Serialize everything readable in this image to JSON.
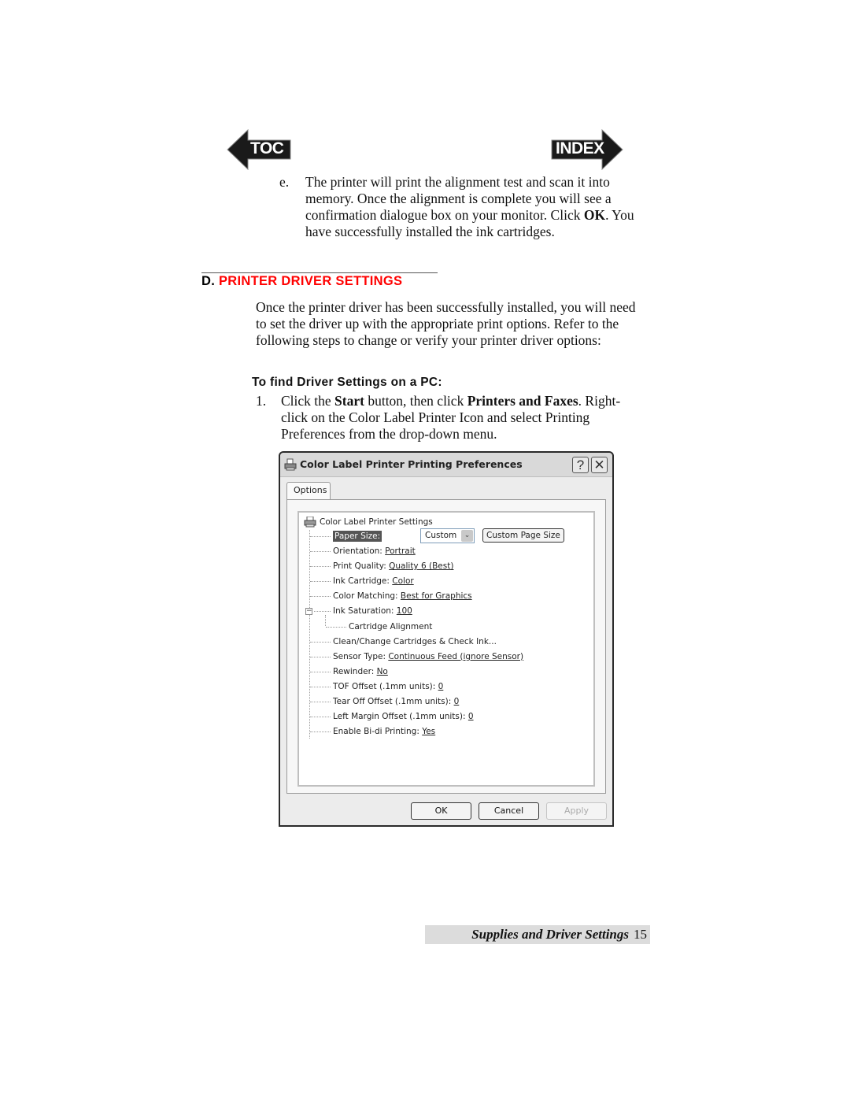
{
  "nav": {
    "toc_label": "TOC",
    "index_label": "INDEX"
  },
  "step_e": {
    "marker": "e.",
    "text_before_ok": "The printer will print the alignment test and scan it into memory.  Once the alignment is complete you will see a confirmation dialogue box on your monitor. Click ",
    "ok_bold": "OK",
    "text_after_ok": ".  You have successfully installed the ink cartridges."
  },
  "section": {
    "letter": "D.",
    "title": "PRINTER DRIVER SETTINGS",
    "title_color": "#ff0000"
  },
  "intro": "Once the printer driver has been successfully installed, you will need to set the driver up with the appropriate print options.  Refer to the following steps to change or verify your printer driver options:",
  "subheading": "To find Driver Settings on a PC:",
  "step_1": {
    "marker": "1.",
    "t1": "Click the ",
    "b1": "Start",
    "t2": " button, then click ",
    "b2": "Printers and Faxes",
    "t3": ". Right-click on the Color Label Printer Icon and select Printing Preferences from the drop-down menu."
  },
  "dialog": {
    "title": "Color Label Printer Printing Preferences",
    "help_glyph": "?",
    "close_glyph": "✕",
    "tab_label": "Options",
    "tree_root": "Color Label Printer Settings",
    "paper_size": {
      "label": "Paper Size:",
      "value": "Custom",
      "dropdown_arrow": "⌄",
      "button": "Custom Page Size"
    },
    "items": [
      {
        "label": "Orientation: ",
        "value": "Portrait"
      },
      {
        "label": "Print Quality: ",
        "value": "Quality 6 (Best)"
      },
      {
        "label": "Ink Cartridge: ",
        "value": "Color"
      },
      {
        "label": "Color Matching: ",
        "value": "Best for Graphics"
      },
      {
        "label": "Ink Saturation: ",
        "value": "100"
      },
      {
        "label": "Cartridge Alignment",
        "value": ""
      },
      {
        "label": "Clean/Change Cartridges & Check Ink...",
        "value": ""
      },
      {
        "label": "Sensor Type: ",
        "value": "Continuous Feed (ignore Sensor)"
      },
      {
        "label": "Rewinder: ",
        "value": "No"
      },
      {
        "label": "TOF Offset (.1mm units): ",
        "value": "0"
      },
      {
        "label": "Tear Off Offset (.1mm units): ",
        "value": "0"
      },
      {
        "label": "Left Margin Offset (.1mm units): ",
        "value": "0"
      },
      {
        "label": "Enable Bi-di Printing: ",
        "value": "Yes"
      }
    ],
    "expander_glyph": "−",
    "ok": "OK",
    "cancel": "Cancel",
    "apply": "Apply"
  },
  "footer": {
    "section": "Supplies and Driver Settings",
    "page": "15"
  }
}
